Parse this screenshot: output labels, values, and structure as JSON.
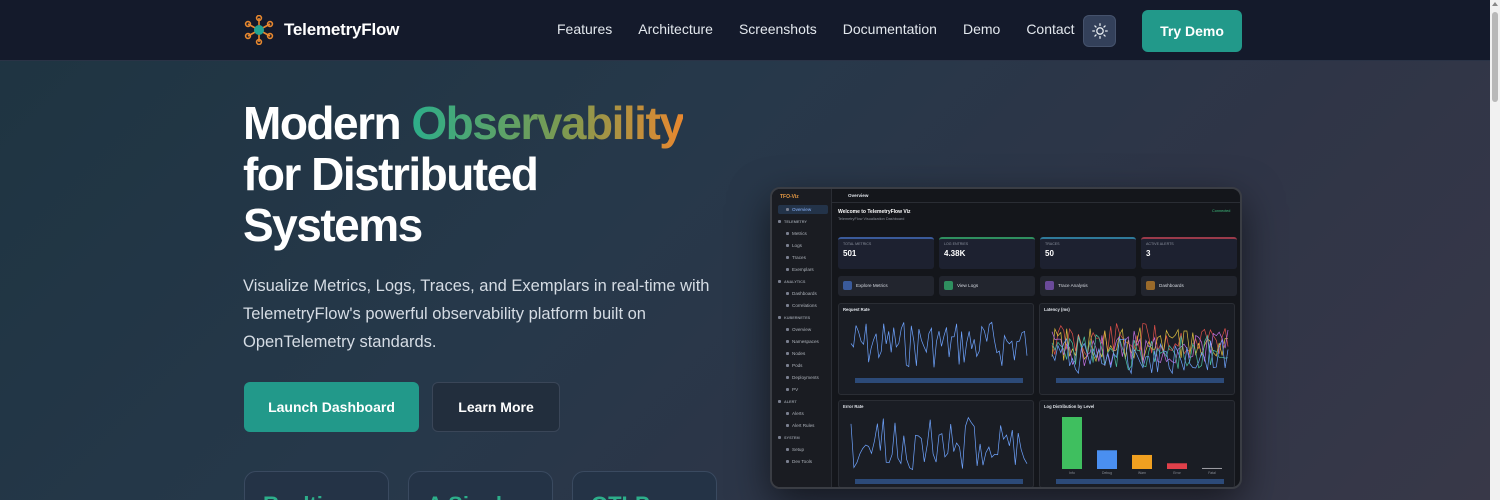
{
  "nav": {
    "brand": "TelemetryFlow",
    "links": [
      "Features",
      "Architecture",
      "Screenshots",
      "Documentation",
      "Demo",
      "Contact"
    ],
    "theme_toggle_icon": "sun-icon",
    "cta": "Try Demo"
  },
  "hero": {
    "title_line1_plain": "Modern ",
    "title_line1_accent": "Observability",
    "title_line2": "for Distributed",
    "title_line3": "Systems",
    "subtitle": "Visualize Metrics, Logs, Traces, and Exemplars in real-time with TelemetryFlow's powerful observability platform built on OpenTelemetry standards.",
    "primary_button": "Launch Dashboard",
    "secondary_button": "Learn More",
    "stat_cards": [
      "Realtime",
      "A Single",
      "OTLP"
    ]
  },
  "preview": {
    "app_name": "TFO-Viz",
    "top_title": "Overview",
    "welcome_title": "Welcome to TelemetryFlow Viz",
    "welcome_subtitle": "TelemetryFlow Visualization Dashboard",
    "connection_status": "Connected",
    "sidebar": [
      {
        "label": "Overview",
        "type": "item",
        "active": true
      },
      {
        "label": "TELEMETRY",
        "type": "group"
      },
      {
        "label": "Metrics",
        "type": "item"
      },
      {
        "label": "Logs",
        "type": "item"
      },
      {
        "label": "Traces",
        "type": "item"
      },
      {
        "label": "Exemplars",
        "type": "item"
      },
      {
        "label": "ANALYTICS",
        "type": "group"
      },
      {
        "label": "Dashboards",
        "type": "item"
      },
      {
        "label": "Correlations",
        "type": "item"
      },
      {
        "label": "KUBERNETES",
        "type": "group"
      },
      {
        "label": "Overview",
        "type": "item"
      },
      {
        "label": "Namespaces",
        "type": "item"
      },
      {
        "label": "Nodes",
        "type": "item"
      },
      {
        "label": "Pods",
        "type": "item"
      },
      {
        "label": "Deployments",
        "type": "item"
      },
      {
        "label": "PV",
        "type": "item"
      },
      {
        "label": "ALERT",
        "type": "group"
      },
      {
        "label": "Alerts",
        "type": "item"
      },
      {
        "label": "Alert Rules",
        "type": "item"
      },
      {
        "label": "SYSTEM",
        "type": "group"
      },
      {
        "label": "Setup",
        "type": "item"
      },
      {
        "label": "Dev Tools",
        "type": "item"
      }
    ],
    "kpis": [
      {
        "label": "Total Metrics",
        "value": "501",
        "color": "#3a5a9a"
      },
      {
        "label": "Log Entries",
        "value": "4.38K",
        "color": "#2f8f5f"
      },
      {
        "label": "Traces",
        "value": "50",
        "color": "#2f7a9a"
      },
      {
        "label": "Active Alerts",
        "value": "3",
        "color": "#9a3a4a"
      }
    ],
    "actions": [
      {
        "label": "Explore Metrics",
        "color": "#3a5a9a"
      },
      {
        "label": "View Logs",
        "color": "#2f8f5f"
      },
      {
        "label": "Trace Analysis",
        "color": "#6a4a9a"
      },
      {
        "label": "Dashboards",
        "color": "#9a6a2a"
      }
    ],
    "panels": [
      {
        "title": "Request Rate"
      },
      {
        "title": "Latency (ms)"
      },
      {
        "title": "Error Rate"
      },
      {
        "title": "Log Distribution by Level"
      }
    ],
    "log_levels": [
      {
        "label": "Info",
        "value": 1.0,
        "color": "#3fbf5f"
      },
      {
        "label": "Debug",
        "value": 0.36,
        "color": "#4a8ff0"
      },
      {
        "label": "Warn",
        "value": 0.27,
        "color": "#f0a020"
      },
      {
        "label": "Error",
        "value": 0.11,
        "color": "#e0404a"
      },
      {
        "label": "Fatal",
        "value": 0.02,
        "color": "#9a9aa0"
      }
    ]
  }
}
